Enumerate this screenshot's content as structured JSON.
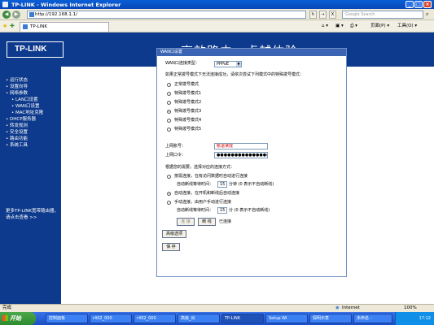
{
  "window": {
    "title": "TP-LINK - Windows Internet Explorer"
  },
  "addressbar": {
    "url": "http://192.168.1.1/",
    "search_placeholder": "Google Search",
    "go_label": "→",
    "close_label": "X"
  },
  "tabbar": {
    "tab_title": "TP-LINK",
    "page_label": "页面(P) ▾",
    "tools_label": "工具(O) ▾"
  },
  "banner": {
    "logo": "TP-LINK",
    "slogan": "高效路由，卓越体验"
  },
  "sidebar": {
    "items": [
      {
        "label": "• 运行状态"
      },
      {
        "label": "• 设置向导"
      },
      {
        "label": "• 网络参数"
      },
      {
        "label": "• LAN口设置"
      },
      {
        "label": "• WAN口设置"
      },
      {
        "label": "• MAC地址克隆"
      },
      {
        "label": "• DHCP服务器"
      },
      {
        "label": "• 转发规则"
      },
      {
        "label": "• 安全设置"
      },
      {
        "label": "• 路由功能"
      },
      {
        "label": "• 系统工具"
      }
    ],
    "more_text": "更多TP-LINK宽带路由器，请点击查看 >>"
  },
  "panel": {
    "title": "WAN口设置",
    "conn_type_label": "WAN口连接类型：",
    "conn_type_value": "PPPoE",
    "hint": "如果正常拨号模式下无法连接成功，请依次尝试下列模式中的特殊拨号模式：",
    "modes": [
      {
        "label": "正常拨号模式",
        "checked": false
      },
      {
        "label": "特殊拨号模式1",
        "checked": false
      },
      {
        "label": "特殊拨号模式2",
        "checked": false
      },
      {
        "label": "特殊拨号模式3",
        "checked": true
      },
      {
        "label": "特殊拨号模式4",
        "checked": false
      },
      {
        "label": "特殊拨号模式5",
        "checked": false
      }
    ],
    "account_label": "上网账号：",
    "account_value": "帐退读成",
    "password_label": "上网口令：",
    "password_value": "●●●●●●●●●●●●●●●",
    "mode_hint": "根据您的需要，选择对应的连接方式：",
    "on_demand_label": "按需连接，在有访问数据时自动进行连接",
    "idle_label_1": "自动断线等待时间：",
    "idle_value_1": "15",
    "idle_unit_1": "分钟 (0 表示不自动断线)",
    "auto_label": "自动连接，在开机和断线后自动连接",
    "manual_label": "手动连接，由用户手动进行连接",
    "idle_label_2": "自动断线等待时间：",
    "idle_value_2": "15",
    "idle_unit_2": "分 (0 表示不自动断线)",
    "connect_btn": "连 接",
    "disconnect_btn": "断 线",
    "status_text": "已连接",
    "advanced_btn": "高级选项",
    "save_btn": "保 存"
  },
  "statusbar": {
    "left": "完成",
    "zone": "Internet",
    "zoom": "100%"
  },
  "taskbar": {
    "start_label": "开始",
    "tasks": [
      {
        "label": "控制面板"
      },
      {
        "label": "r402_000"
      },
      {
        "label": "r402_000"
      },
      {
        "label": "高级_出"
      },
      {
        "label": "TP-LINK"
      },
      {
        "label": "Setup Wi"
      },
      {
        "label": "探明示意"
      },
      {
        "label": "未命名 -"
      }
    ],
    "clock": "17:12"
  },
  "colors": {
    "banner": "#0d3a8c",
    "panel_head": "#3c64b4",
    "taskbar": "#245edb",
    "start": "#3c9a3c"
  }
}
